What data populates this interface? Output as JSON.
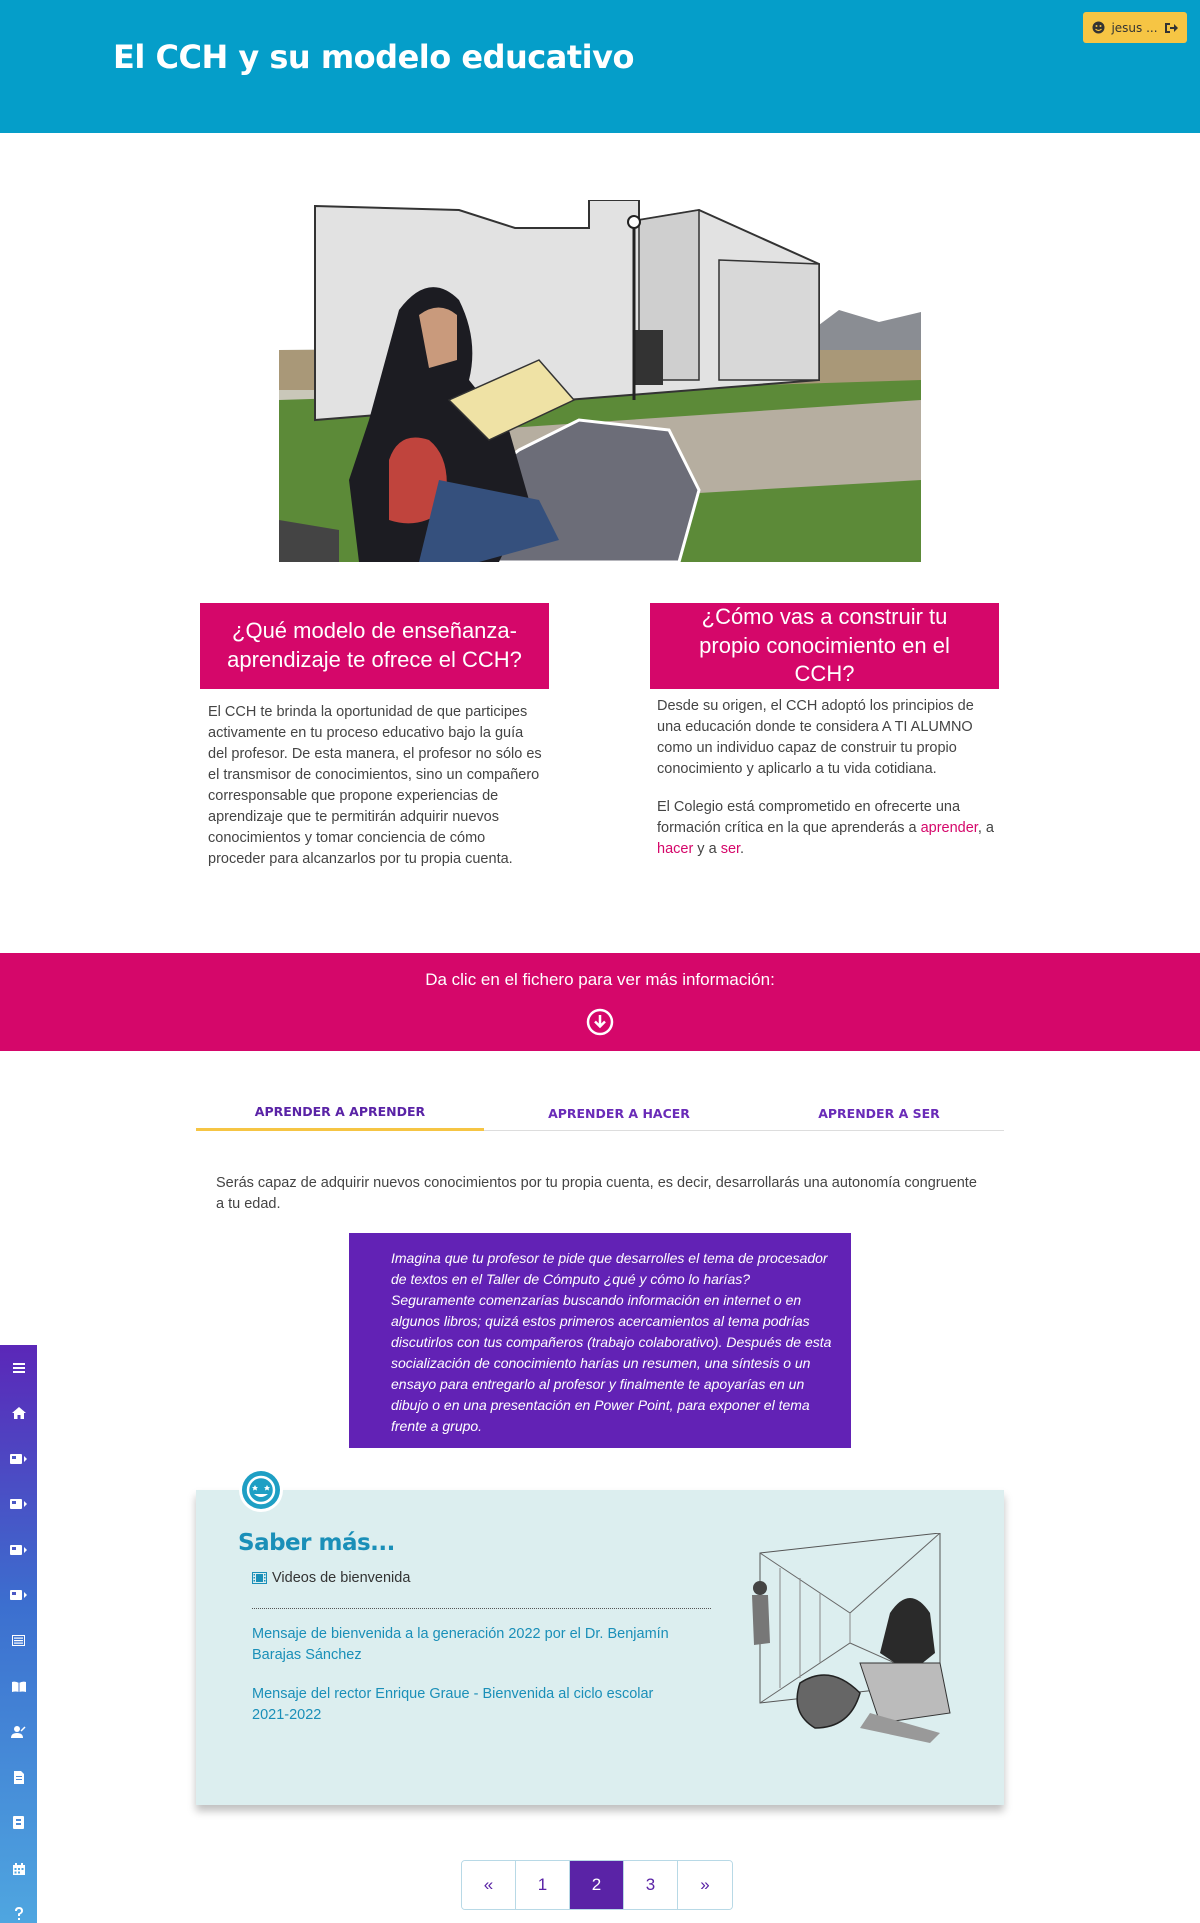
{
  "header": {
    "title": "El CCH y su modelo educativo"
  },
  "user": {
    "label": "jesus ..."
  },
  "intro": {
    "q1": "¿Qué modelo de enseñanza-aprendizaje te ofrece el CCH?",
    "q2": "¿Cómo vas a construir tu propio conocimiento en el CCH?",
    "p1": "El CCH te brinda la oportunidad de que participes activamente en tu proceso educativo bajo la guía del profesor. De esta manera, el profesor no sólo es el transmisor de conocimientos, sino un compañero corresponsable que propone experiencias de aprendizaje que te permitirán adquirir nuevos conocimientos y tomar conciencia de cómo proceder para alcanzarlos por tu propia cuenta.",
    "p2": "Desde su origen, el CCH adoptó los principios de una educación donde te considera A TI ALUMNO como un individuo capaz de construir tu propio conocimiento y aplicarlo a tu vida cotidiana.",
    "p3_start": "El Colegio está comprometido en ofrecerte una formación crítica en la que aprenderás a ",
    "p3_link1": "aprender",
    "p3_comma": ", a ",
    "p3_link2": "hacer",
    "p3_and": " y a ",
    "p3_link3": "ser",
    "p3_end": "."
  },
  "banner": {
    "text": "Da clic en el fichero para ver más información:"
  },
  "tabs": [
    {
      "label": "APRENDER A APRENDER",
      "active": true
    },
    {
      "label": "APRENDER A HACER",
      "active": false
    },
    {
      "label": "APRENDER A SER",
      "active": false
    }
  ],
  "tab_content": {
    "description": "Serás capaz de adquirir nuevos conocimientos por tu propia cuenta, es decir, desarrollarás una autonomía congruente a tu edad.",
    "example": "Imagina que tu profesor te pide que desarrolles el tema de procesador de textos en el Taller de Cómputo ¿qué y cómo lo harías? Seguramente comenzarías buscando información en internet o en algunos libros; quizá estos primeros acercamientos al tema podrías discutirlos con tus compañeros (trabajo colaborativo). Después de esta socialización de conocimiento harías un resumen, una síntesis o un ensayo para entregarlo al profesor y finalmente te apoyarías en un dibujo o en una presentación en Power Point, para exponer el tema frente a grupo."
  },
  "saber_mas": {
    "title": "Saber más...",
    "videos_label": "Videos de bienvenida",
    "links": [
      "Mensaje de bienvenida a la generación 2022 por el Dr. Benjamín Barajas Sánchez",
      "Mensaje del rector Enrique Graue - Bienvenida al ciclo escolar 2021-2022"
    ]
  },
  "pagination": {
    "first": "«",
    "pages": [
      "1",
      "2",
      "3"
    ],
    "current": "2",
    "last": "»"
  },
  "sidebar": {
    "icons": [
      "menu-icon",
      "home-icon",
      "module-icon",
      "module-icon",
      "module-icon",
      "module-icon",
      "list-icon",
      "book-icon",
      "user-icon",
      "document-icon",
      "file-icon",
      "calendar-icon",
      "help-icon"
    ]
  },
  "colors": {
    "header": "#059ec9",
    "pink": "#d5076a",
    "purple": "#6222b5",
    "yellow": "#f6c544",
    "teal_box": "#dceeef",
    "link": "#1a8fb8"
  }
}
